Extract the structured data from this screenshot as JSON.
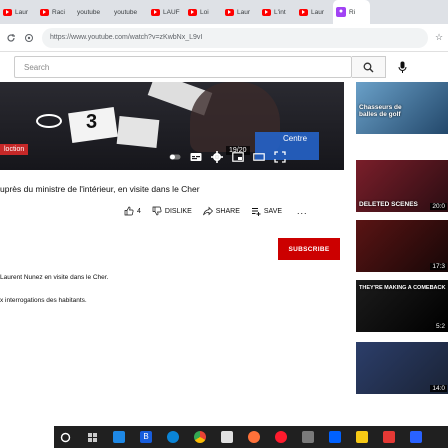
{
  "browser": {
    "tabs": [
      {
        "label": "Laur"
      },
      {
        "label": "Raci"
      },
      {
        "label": "youtube"
      },
      {
        "label": "youtube"
      },
      {
        "label": "LAUF"
      },
      {
        "label": "Loi"
      },
      {
        "label": "Laur"
      },
      {
        "label": "L'int"
      },
      {
        "label": "Laur"
      },
      {
        "label": "Ri"
      }
    ],
    "url": "https://www.youtube.com/watch?v=zKwbNx_L9vI"
  },
  "youtube": {
    "search_placeholder": "Search"
  },
  "player": {
    "card_number": "3",
    "badge": "loction",
    "overlay_label": "Centre",
    "subtitle": "19/20"
  },
  "video": {
    "title": "uprès du ministre de l'intérieur, en visite dans le Cher",
    "likes": "4",
    "dislike_label": "DISLIKE",
    "share_label": "SHARE",
    "save_label": "SAVE",
    "more": "...",
    "subscribe_label": "SUBSCRIBE",
    "description_line1": "Laurent Nunez en visite dans le Cher.",
    "description_line2": "x interrogations des habitants."
  },
  "sidebar": {
    "items": [
      {
        "caption": "Chasseurs de\nballes de golf",
        "duration": "",
        "colors": [
          "#6aa0c8",
          "#23486b"
        ]
      },
      {
        "caption": "DELETED SCENES",
        "duration": "20:0",
        "colors": [
          "#7a1e2a",
          "#2b0d12"
        ]
      },
      {
        "caption": "",
        "duration": "17:3",
        "colors": [
          "#5a1414",
          "#170707"
        ]
      },
      {
        "caption": "THEY'RE MAKING A COMEBACK",
        "duration": "5:2",
        "colors": [
          "#1c1c1c",
          "#000000"
        ]
      },
      {
        "caption": "",
        "duration": "14:0",
        "colors": [
          "#2c3e6a",
          "#1a2336"
        ]
      }
    ]
  },
  "taskbar": {
    "icons": [
      "windows-icon",
      "task-view-icon",
      "file-explorer-icon",
      "bitwarden-icon",
      "edge-icon",
      "chrome-icon",
      "calendar-icon",
      "firefox-icon",
      "opera-icon",
      "app-icon",
      "dropbox-icon",
      "notes-icon",
      "app2-icon",
      "app3-icon"
    ]
  }
}
